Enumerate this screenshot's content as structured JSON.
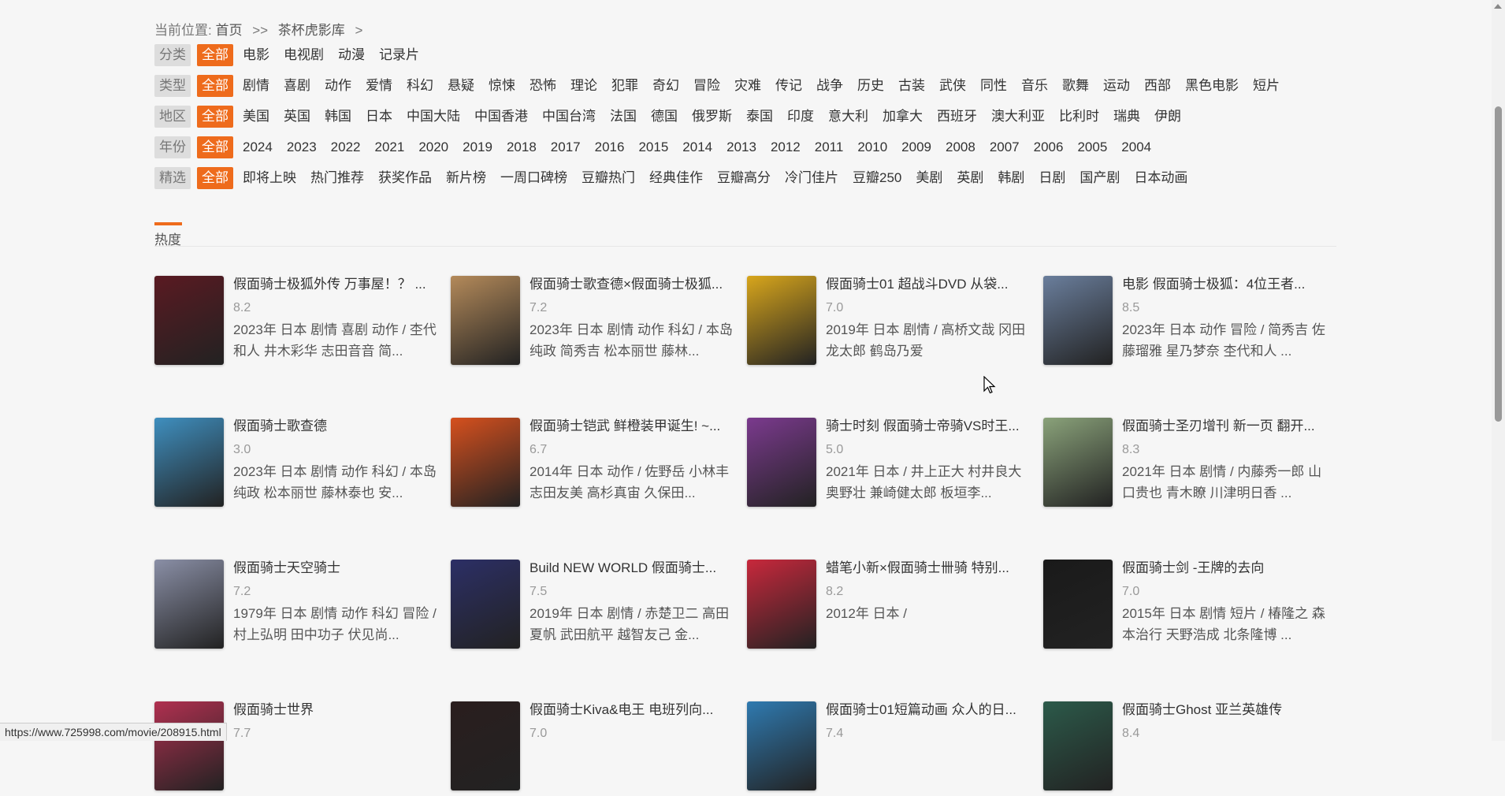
{
  "breadcrumb": {
    "prefix": "当前位置:",
    "home": "首页",
    "sep1": ">>",
    "current": "茶杯虎影库",
    "sep2": ">"
  },
  "filters": [
    {
      "key": "分类",
      "items": [
        "全部",
        "电影",
        "电视剧",
        "动漫",
        "记录片"
      ]
    },
    {
      "key": "类型",
      "items": [
        "全部",
        "剧情",
        "喜剧",
        "动作",
        "爱情",
        "科幻",
        "悬疑",
        "惊悚",
        "恐怖",
        "理论",
        "犯罪",
        "奇幻",
        "冒险",
        "灾难",
        "传记",
        "战争",
        "历史",
        "古装",
        "武侠",
        "同性",
        "音乐",
        "歌舞",
        "运动",
        "西部",
        "黑色电影",
        "短片"
      ]
    },
    {
      "key": "地区",
      "items": [
        "全部",
        "美国",
        "英国",
        "韩国",
        "日本",
        "中国大陆",
        "中国香港",
        "中国台湾",
        "法国",
        "德国",
        "俄罗斯",
        "泰国",
        "印度",
        "意大利",
        "加拿大",
        "西班牙",
        "澳大利亚",
        "比利时",
        "瑞典",
        "伊朗"
      ]
    },
    {
      "key": "年份",
      "items": [
        "全部",
        "2024",
        "2023",
        "2022",
        "2021",
        "2020",
        "2019",
        "2018",
        "2017",
        "2016",
        "2015",
        "2014",
        "2013",
        "2012",
        "2011",
        "2010",
        "2009",
        "2008",
        "2007",
        "2006",
        "2005",
        "2004"
      ]
    },
    {
      "key": "精选",
      "items": [
        "全部",
        "即将上映",
        "热门推荐",
        "获奖作品",
        "新片榜",
        "一周口碑榜",
        "豆瓣热门",
        "经典佳作",
        "豆瓣高分",
        "冷门佳片",
        "豆瓣250",
        "美剧",
        "英剧",
        "韩剧",
        "日剧",
        "国产剧",
        "日本动画"
      ]
    }
  ],
  "sort_tab": "热度",
  "movies": [
    {
      "title": "假面骑士极狐外传 万事屋！？ ...",
      "score": "8.2",
      "desc": "2023年 日本 剧情 喜剧 动作 / 杢代和人 井木彩华 志田音音 简...",
      "color": "#5a1a22"
    },
    {
      "title": "假面骑士歌查德×假面骑士极狐...",
      "score": "7.2",
      "desc": "2023年 日本 剧情 动作 科幻 / 本岛纯政 简秀吉 松本丽世 藤林...",
      "color": "#b48a5a"
    },
    {
      "title": "假面骑士01 超战斗DVD 从袋...",
      "score": "7.0",
      "desc": "2019年 日本 剧情 / 高桥文哉 冈田龙太郎 鹤岛乃爱",
      "color": "#d8a61c"
    },
    {
      "title": "电影 假面骑士极狐：4位王者...",
      "score": "8.5",
      "desc": "2023年 日本 动作 冒险 / 简秀吉 佐藤瑠雅 星乃梦奈 杢代和人 ...",
      "color": "#6a7e9c"
    },
    {
      "title": "假面骑士歌查德",
      "score": "3.0",
      "desc": "2023年 日本 剧情 动作 科幻 / 本岛纯政 松本丽世 藤林泰也 安...",
      "color": "#3f8fbf"
    },
    {
      "title": "假面骑士铠武 鲜橙装甲诞生! ~...",
      "score": "6.7",
      "desc": "2014年 日本 动作 / 佐野岳 小林丰 志田友美 高杉真宙 久保田...",
      "color": "#d6501e"
    },
    {
      "title": "骑士时刻 假面骑士帝骑VS时王...",
      "score": "5.0",
      "desc": "2021年 日本 / 井上正大 村井良大 奥野壮 兼崎健太郎 板垣李...",
      "color": "#7b3a8e"
    },
    {
      "title": "假面骑士圣刃增刊 新一页 翻开...",
      "score": "8.3",
      "desc": "2021年 日本 剧情 / 内藤秀一郎 山口贵也 青木瞭 川津明日香 ...",
      "color": "#8aa27a"
    },
    {
      "title": "假面骑士天空骑士",
      "score": "7.2",
      "desc": "1979年 日本 剧情 动作 科幻 冒险 / 村上弘明 田中功子 伏见尚...",
      "color": "#8a8fa6"
    },
    {
      "title": "Build NEW WORLD 假面骑士...",
      "score": "7.5",
      "desc": "2019年 日本 剧情 / 赤楚卫二 高田夏帆 武田航平 越智友己 金...",
      "color": "#2c2f66"
    },
    {
      "title": "蜡笔小新×假面骑士卌骑 特别...",
      "score": "8.2",
      "desc": "2012年 日本 /",
      "color": "#c8283c"
    },
    {
      "title": "假面骑士剑 -王牌的去向",
      "score": "7.0",
      "desc": "2015年 日本 剧情 短片 / 椿隆之 森本治行 天野浩成 北条隆博 ...",
      "color": "#1a1a1a"
    },
    {
      "title": "假面骑士世界",
      "score": "7.7",
      "desc": "",
      "color": "#b03050"
    },
    {
      "title": "假面骑士Kiva&电王 电班列向...",
      "score": "7.0",
      "desc": "",
      "color": "#2a1e1e"
    },
    {
      "title": "假面骑士01短篇动画 众人的日...",
      "score": "7.4",
      "desc": "",
      "color": "#2f7ab0"
    },
    {
      "title": "假面骑士Ghost 亚兰英雄传",
      "score": "8.4",
      "desc": "",
      "color": "#2c5a4a"
    }
  ],
  "status_url": "https://www.725998.com/movie/208915.html"
}
